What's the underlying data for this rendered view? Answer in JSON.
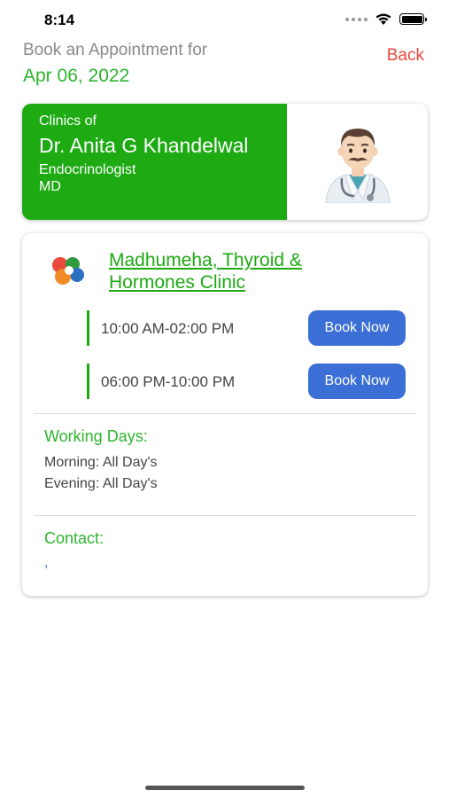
{
  "status_bar": {
    "time": "8:14",
    "icons": [
      "cellular-signal-icon",
      "wifi-icon",
      "battery-icon"
    ]
  },
  "header": {
    "prompt": "Book an Appointment for",
    "date": "Apr 06, 2022",
    "back_label": "Back"
  },
  "doctor": {
    "clinics_of": "Clinics of",
    "name": "Dr. Anita G Khandelwal",
    "specialty": "Endocrinologist",
    "degree": "MD",
    "avatar_icon": "doctor-avatar-icon"
  },
  "clinic": {
    "logo_icon": "clinic-logo-icon",
    "name": "Madhumeha, Thyroid & Hormones Clinic",
    "slots": [
      {
        "time": "10:00 AM-02:00 PM",
        "button_label": "Book Now"
      },
      {
        "time": "06:00 PM-10:00 PM",
        "button_label": "Book Now"
      }
    ],
    "working_days": {
      "title": "Working Days:",
      "morning": "Morning: All Day's",
      "evening": "Evening: All Day's"
    },
    "contact": {
      "title": "Contact:",
      "value": ","
    }
  },
  "colors": {
    "brand_green": "#1daa13",
    "button_blue": "#3b6fd6",
    "back_red": "#e8483c"
  }
}
